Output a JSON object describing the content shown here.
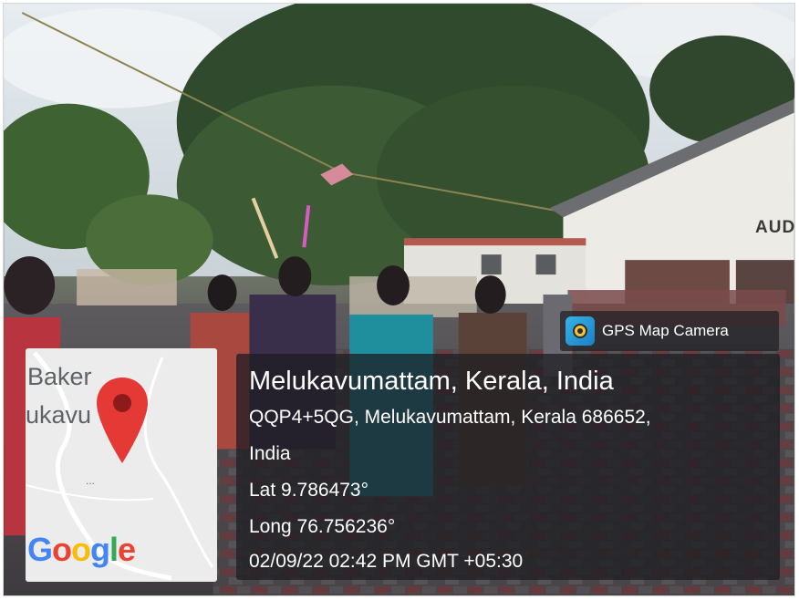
{
  "building_sign": "AUD",
  "stamp": {
    "app_name": "GPS Map Camera",
    "place": "Melukavumattam, Kerala, India",
    "address_line1": "QQP4+5QG, Melukavumattam, Kerala 686652,",
    "address_line2": "India",
    "latitude": "Lat 9.786473°",
    "longitude": "Long 76.756236°",
    "timestamp": "02/09/22 02:42 PM GMT +05:30"
  },
  "map": {
    "label_line1": "Baker",
    "label_line2": "ukavu",
    "dots": "...",
    "logo_letters": [
      "G",
      "o",
      "o",
      "g",
      "l",
      "e"
    ],
    "pin_color": "#e53935"
  }
}
